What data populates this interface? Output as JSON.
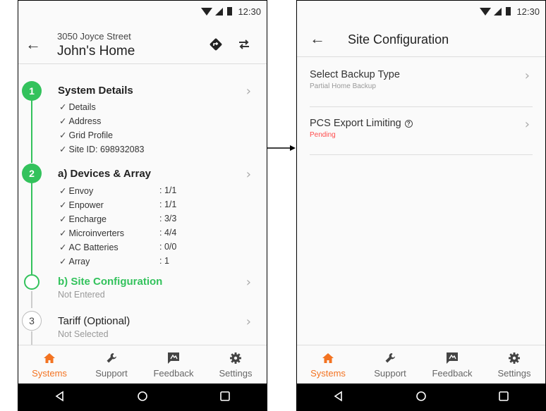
{
  "status_bar": {
    "time": "12:30"
  },
  "left_screen": {
    "header": {
      "address_line": "3050 Joyce Street",
      "title": "John's Home"
    },
    "steps": [
      {
        "number": "1",
        "title": "System Details",
        "checklist": [
          "Details",
          "Address",
          "Grid Profile",
          "Site ID: 698932083"
        ]
      },
      {
        "number": "2",
        "title": "a) Devices & Array",
        "checklist": [
          {
            "label": "Envoy",
            "value": ": 1/1"
          },
          {
            "label": "Enpower",
            "value": ": 1/1"
          },
          {
            "label": "Encharge",
            "value": ": 3/3"
          },
          {
            "label": "Microinverters",
            "value": ": 4/4"
          },
          {
            "label": "AC Batteries",
            "value": ": 0/0"
          },
          {
            "label": "Array",
            "value": ": 1"
          }
        ]
      },
      {
        "title": "b) Site Configuration",
        "status": "Not Entered"
      },
      {
        "number": "3",
        "title": "Tariff (Optional)",
        "status": "Not Selected"
      }
    ]
  },
  "right_screen": {
    "title": "Site Configuration",
    "rows": [
      {
        "title": "Select Backup Type",
        "subtitle": "Partial Home Backup"
      },
      {
        "title": "PCS Export Limiting",
        "subtitle": "Pending"
      }
    ]
  },
  "bottom_nav": {
    "items": [
      {
        "label": "Systems",
        "icon": "home-icon",
        "active": true
      },
      {
        "label": "Support",
        "icon": "wrench-icon"
      },
      {
        "label": "Feedback",
        "icon": "feedback-icon"
      },
      {
        "label": "Settings",
        "icon": "gear-icon"
      }
    ]
  },
  "colors": {
    "accent": "#f37321",
    "step_complete": "#33c25c",
    "pending": "#ff4b4b"
  }
}
